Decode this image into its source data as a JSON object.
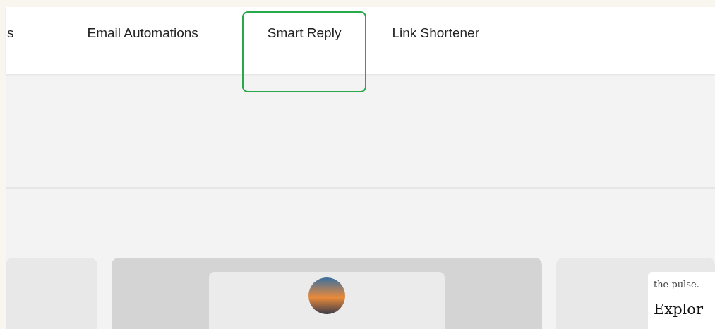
{
  "tabs": [
    {
      "label": "s",
      "selected": false
    },
    {
      "label": "Email Automations",
      "selected": false
    },
    {
      "label": "Smart Reply",
      "selected": true
    },
    {
      "label": "Link Shortener",
      "selected": false
    }
  ],
  "preview_card": {
    "text": "the pulse.",
    "heading": "Explor"
  }
}
